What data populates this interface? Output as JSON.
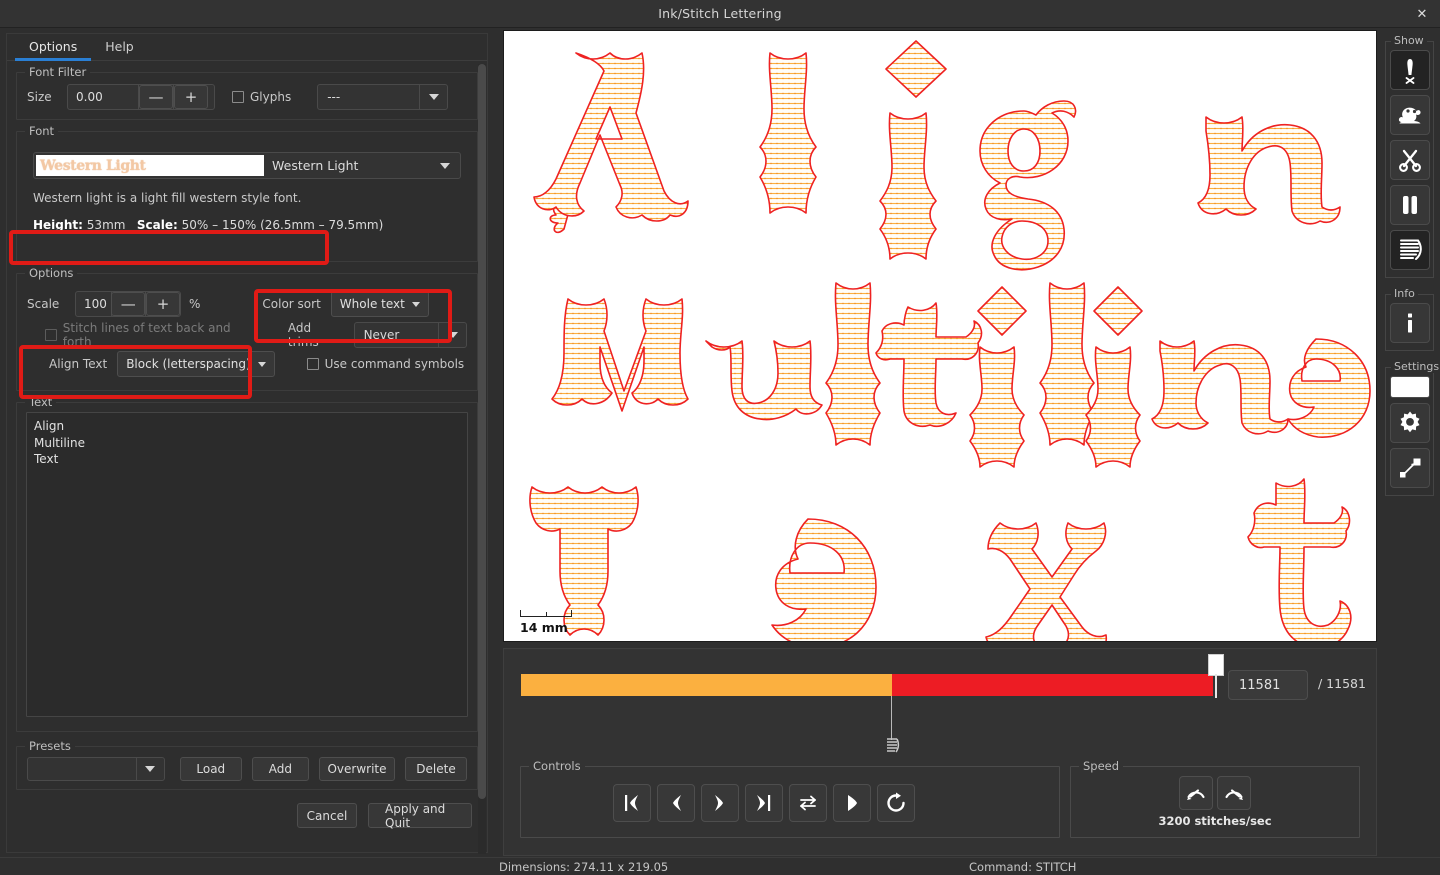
{
  "window": {
    "title": "Ink/Stitch Lettering",
    "close_label": "✕"
  },
  "tabs": [
    {
      "label": "Options",
      "active": true
    },
    {
      "label": "Help",
      "active": false
    }
  ],
  "font_filter": {
    "group_label": "Font Filter",
    "size_label": "Size",
    "size_value": "0.00",
    "minus_label": "—",
    "plus_label": "+",
    "glyphs_label": "Glyphs",
    "glyphs_checked": false,
    "filter_value": "---"
  },
  "font": {
    "group_label": "Font",
    "preview_text": "Western Light",
    "name": "Western Light",
    "description": "Western light is a light fill western style font.",
    "height_label": "Height:",
    "height_value": "53mm",
    "scale_label": "Scale:",
    "scale_value": "50% – 150% (26.5mm – 79.5mm)"
  },
  "options": {
    "group_label": "Options",
    "scale_label": "Scale",
    "scale_value": "100",
    "scale_unit": "%",
    "minus_label": "—",
    "plus_label": "+",
    "stitch_back_forth_label": "Stitch lines of text back and forth",
    "stitch_back_forth_checked": false,
    "align_text_label": "Align Text",
    "align_text_value": "Block (letterspacing)",
    "color_sort_label": "Color sort",
    "color_sort_value": "Whole text",
    "add_trims_label": "Add trims",
    "add_trims_value": "Never",
    "use_command_symbols_label": "Use command symbols",
    "use_command_symbols_checked": false
  },
  "text": {
    "group_label": "Text",
    "lines": [
      "Align",
      "Multiline",
      "Text"
    ]
  },
  "presets": {
    "group_label": "Presets",
    "selected": "",
    "load_label": "Load",
    "add_label": "Add",
    "overwrite_label": "Overwrite",
    "delete_label": "Delete"
  },
  "footer": {
    "cancel_label": "Cancel",
    "apply_label": "Apply and Quit"
  },
  "canvas": {
    "lines": [
      "Align",
      "Multiline",
      "Text"
    ],
    "scale_bar_label": "14 mm",
    "stitch_outline_color": "#ee2222",
    "stitch_fill_color": "#fbb040"
  },
  "simulator": {
    "stitch_current": "11581",
    "stitch_total": "/ 11581",
    "color_segments": [
      {
        "color": "#FBB040",
        "name": "orange-thread"
      },
      {
        "color": "#ED1C24",
        "name": "red-thread"
      }
    ],
    "controls_label": "Controls",
    "controls": [
      {
        "name": "jump-to-start",
        "glyph": "|❮"
      },
      {
        "name": "step-backward",
        "glyph": "❮"
      },
      {
        "name": "step-forward",
        "glyph": "❯"
      },
      {
        "name": "jump-to-end",
        "glyph": "❯|"
      },
      {
        "name": "toggle-direction",
        "glyph": "⇄"
      },
      {
        "name": "play",
        "glyph": "▶"
      },
      {
        "name": "restart",
        "glyph": "↻"
      }
    ],
    "speed_label": "Speed",
    "slow_down_label": "slow-down",
    "speed_up_label": "speed-up",
    "speed_value": "3200 stitches/sec"
  },
  "right_toolbar": {
    "show_label": "Show",
    "show_items": [
      {
        "name": "needle-penetration-points-icon",
        "active": true
      },
      {
        "name": "jump-stitches-icon",
        "active": false
      },
      {
        "name": "trims-icon",
        "active": false
      },
      {
        "name": "stops-icon",
        "active": false
      },
      {
        "name": "page-specs-icon",
        "active": true
      }
    ],
    "info_label": "Info",
    "info_items": [
      {
        "name": "info-icon"
      }
    ],
    "settings_label": "Settings",
    "background_color": "#ffffff",
    "settings_items": [
      {
        "name": "background-color-swatch"
      },
      {
        "name": "gear-icon"
      },
      {
        "name": "resize-icon"
      }
    ]
  },
  "status_bar": {
    "dimensions": "Dimensions: 274.11 x 219.05",
    "command": "Command: STITCH"
  }
}
